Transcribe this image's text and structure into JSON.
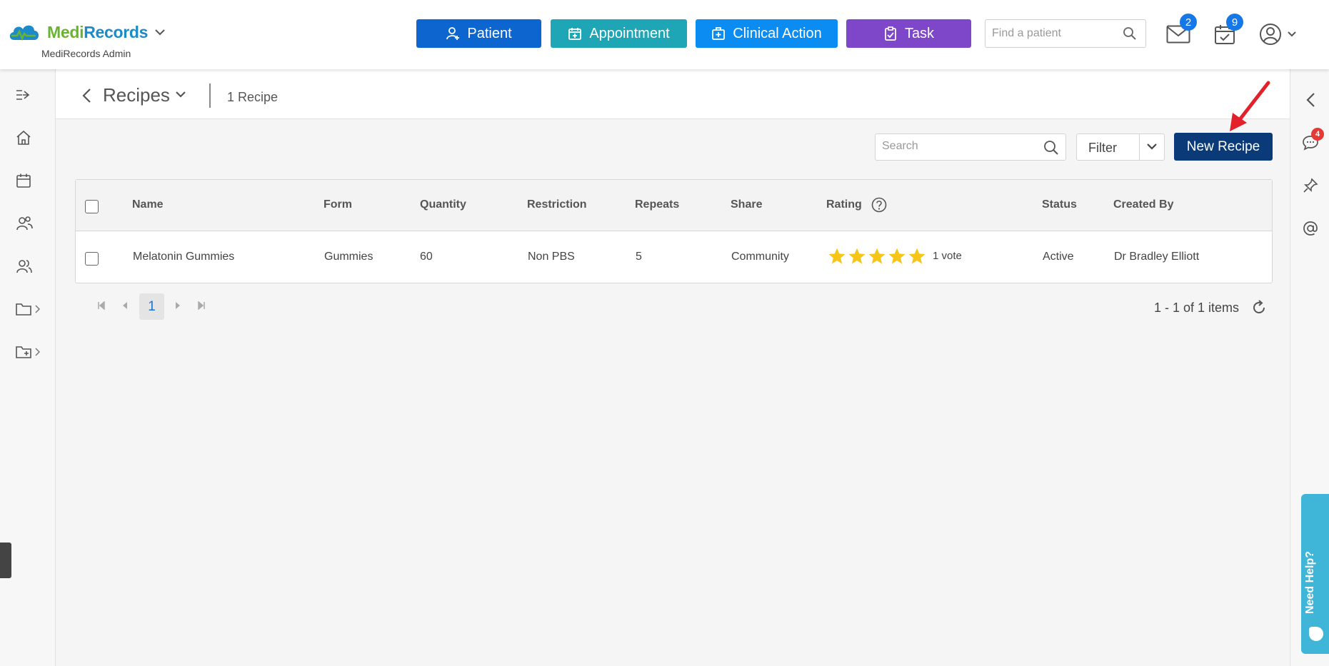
{
  "brand": {
    "name_part1": "Medi",
    "name_part2": "Records",
    "subtitle": "MediRecords Admin"
  },
  "header": {
    "buttons": {
      "patient": "Patient",
      "appointment": "Appointment",
      "clinical_action": "Clinical Action",
      "task": "Task"
    },
    "find_patient_placeholder": "Find a patient",
    "mail_count": "2",
    "calendar_count": "9"
  },
  "page": {
    "title": "Recipes",
    "count_label": "1 Recipe"
  },
  "toolbar": {
    "search_placeholder": "Search",
    "filter_label": "Filter",
    "new_recipe_label": "New Recipe"
  },
  "table": {
    "headers": {
      "name": "Name",
      "form": "Form",
      "quantity": "Quantity",
      "restriction": "Restriction",
      "repeats": "Repeats",
      "share": "Share",
      "rating": "Rating",
      "status": "Status",
      "created_by": "Created By"
    },
    "rows": [
      {
        "name": "Melatonin Gummies",
        "form": "Gummies",
        "quantity": "60",
        "restriction": "Non PBS",
        "repeats": "5",
        "share": "Community",
        "rating": 5,
        "votes": "1 vote",
        "status": "Active",
        "created_by": "Dr Bradley Elliott"
      }
    ]
  },
  "pagination": {
    "current_page": "1",
    "info": "1 - 1 of 1 items"
  },
  "right_rail": {
    "chat_count": "4",
    "help_label": "Need Help?"
  },
  "colors": {
    "patient": "#0d66d0",
    "appointment": "#1fa6b6",
    "clinical_action": "#0b8cf2",
    "task": "#7e46c9",
    "new_recipe": "#0a3a78",
    "star": "#f5c518",
    "badge": "#1678e8",
    "alert_badge": "#e53935",
    "help_tab": "#3fb6d8"
  },
  "icons": {
    "nav": [
      "expand-menu-icon",
      "home-icon",
      "calendar-icon",
      "patients-icon",
      "users-icon",
      "folder-icon",
      "folder-add-icon"
    ],
    "rail": [
      "collapse-panel-icon",
      "chat-icon",
      "pin-icon",
      "mention-icon"
    ]
  }
}
